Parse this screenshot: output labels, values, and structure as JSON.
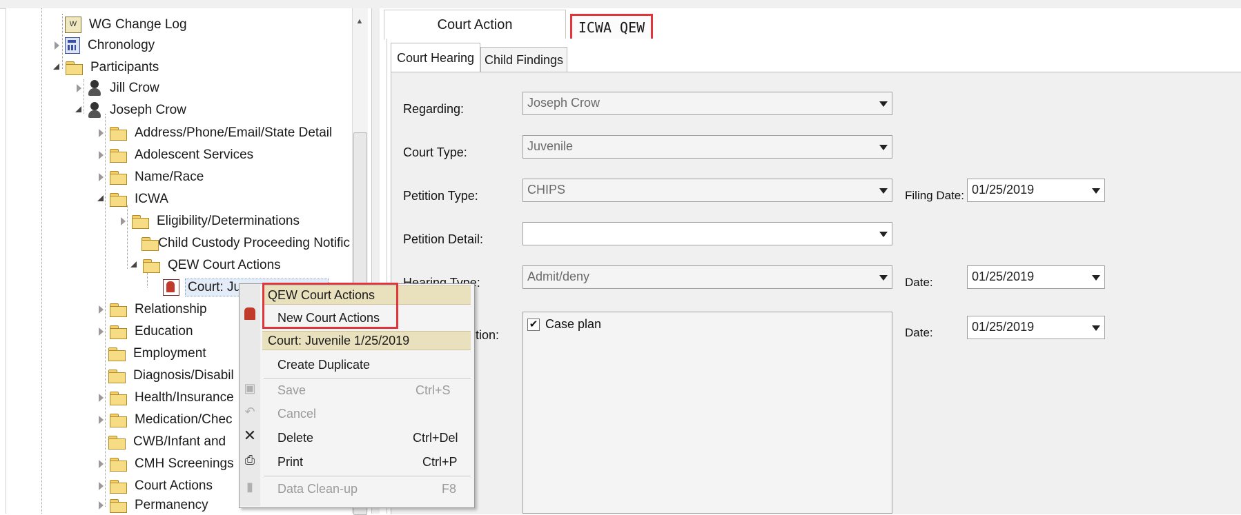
{
  "tree": {
    "items": [
      {
        "label": "WG Change Log"
      },
      {
        "label": "Chronology"
      },
      {
        "label": "Participants"
      },
      {
        "label": "Jill Crow"
      },
      {
        "label": "Joseph Crow"
      },
      {
        "label": "Address/Phone/Email/State Detail"
      },
      {
        "label": "Adolescent Services"
      },
      {
        "label": "Name/Race"
      },
      {
        "label": "ICWA"
      },
      {
        "label": "Eligibility/Determinations"
      },
      {
        "label": "Child Custody Proceeding Notific"
      },
      {
        "label": "QEW Court Actions"
      },
      {
        "label": "Court: Ju"
      },
      {
        "label": "Relationship"
      },
      {
        "label": "Education"
      },
      {
        "label": "Employment"
      },
      {
        "label": "Diagnosis/Disabil"
      },
      {
        "label": "Health/Insurance"
      },
      {
        "label": "Medication/Chec"
      },
      {
        "label": "CWB/Infant and"
      },
      {
        "label": "CMH Screenings"
      },
      {
        "label": "Court Actions"
      },
      {
        "label": "Permanency"
      }
    ]
  },
  "tabs": {
    "outer": [
      "Court Action",
      "ICWA QEW"
    ],
    "inner": [
      "Court Hearing",
      "Child Findings"
    ]
  },
  "form": {
    "regarding_label": "Regarding:",
    "regarding_value": "Joseph Crow",
    "court_type_label": "Court Type:",
    "court_type_value": "Juvenile",
    "petition_type_label": "Petition Type:",
    "petition_type_value": "CHIPS",
    "filing_date_label": "Filing Date:",
    "filing_date_value": "01/25/2019",
    "petition_detail_label": "Petition Detail:",
    "petition_detail_value": "",
    "hearing_type_label": "Hearing Type:",
    "hearing_type_value": "Admit/deny",
    "hearing_date_label": "Date:",
    "hearing_date_value": "01/25/2019",
    "disposition_label": "sition:",
    "disposition_item": "Case plan",
    "disposition_checked": true,
    "disposition_date_label": "Date:",
    "disposition_date_value": "01/25/2019"
  },
  "context_menu": {
    "header1": "QEW Court Actions",
    "new_court_actions": "New Court Actions",
    "header2": "Court: Juvenile 1/25/2019",
    "create_duplicate": "Create Duplicate",
    "save": "Save",
    "save_shortcut": "Ctrl+S",
    "cancel": "Cancel",
    "delete": "Delete",
    "delete_shortcut": "Ctrl+Del",
    "print": "Print",
    "print_shortcut": "Ctrl+P",
    "data_cleanup": "Data Clean-up",
    "data_cleanup_shortcut": "F8"
  },
  "colors": {
    "highlight_red": "#e0353a",
    "menu_header": "#e9e1bd",
    "folder": "#f6dc84"
  }
}
